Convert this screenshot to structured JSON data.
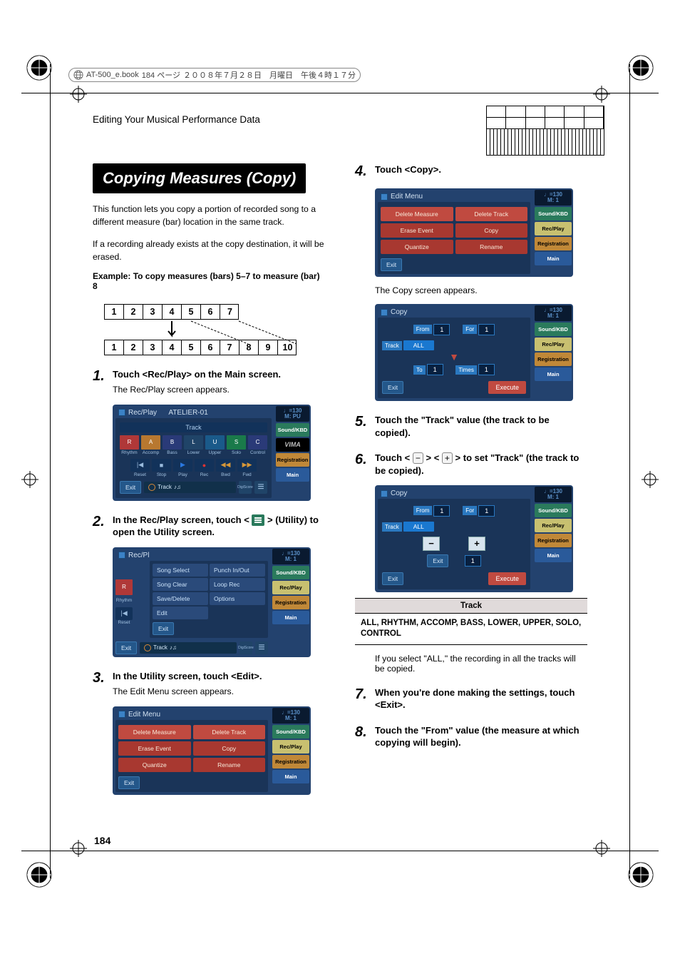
{
  "header": {
    "file": "AT-500_e.book",
    "page_info": "184 ページ",
    "date": "２００８年７月２８日　月曜日　午後４時１７分"
  },
  "section_heading": "Editing Your Musical Performance Data",
  "title": "Copying Measures (Copy)",
  "intro_p1": "This function lets you copy a portion of recorded song to a different measure (bar) location in the same track.",
  "intro_p2": "If a recording already exists at the copy destination, it will be erased.",
  "example_label": "Example: To copy measures (bars) 5–7 to measure (bar) 8",
  "diagram": {
    "row1": [
      "1",
      "2",
      "3",
      "4",
      "5",
      "6",
      "7"
    ],
    "row2": [
      "1",
      "2",
      "3",
      "4",
      "5",
      "6",
      "7",
      "8",
      "9",
      "10"
    ]
  },
  "steps": {
    "s1": {
      "num": "1.",
      "title": "Touch <Rec/Play> on the Main screen.",
      "sub": "The Rec/Play screen appears."
    },
    "s2": {
      "num": "2.",
      "title_pre": "In the Rec/Play screen, touch < ",
      "title_post": " > (Utility) to open the Utility screen."
    },
    "s3": {
      "num": "3.",
      "title": "In the Utility screen, touch <Edit>.",
      "sub": "The Edit Menu screen appears."
    },
    "s4": {
      "num": "4.",
      "title": "Touch <Copy>.",
      "sub": "The Copy screen appears."
    },
    "s5": {
      "num": "5.",
      "title": "Touch the \"Track\" value (the track to be copied)."
    },
    "s6": {
      "num": "6.",
      "title_pre": "Touch < ",
      "title_mid": " > < ",
      "title_post": " > to set \"Track\" (the track to be copied)."
    },
    "s7": {
      "num": "7.",
      "title": "When you're done making the settings, touch <Exit>."
    },
    "s8": {
      "num": "8.",
      "title": "Touch the \"From\" value (the measure at which copying will begin)."
    }
  },
  "track_table": {
    "header": "Track",
    "value": "ALL, RHYTHM, ACCOMP, BASS, LOWER, UPPER, SOLO, CONTROL"
  },
  "all_note": "If you select \"ALL,\" the recording in all the tracks will be copied.",
  "screenshots": {
    "common_side": {
      "tempo_label": "=130",
      "tempo_m": "M:",
      "sound": "Sound/KBD",
      "rec": "Rec/Play",
      "vima": "VIMA",
      "reg": "Registration",
      "main": "Main"
    },
    "recplay": {
      "title": "Rec/Play",
      "subtitle": "ATELIER-01",
      "track_label": "Track",
      "tiles": [
        "R",
        "A",
        "B",
        "L",
        "U",
        "S",
        "C"
      ],
      "tile_labels": [
        "Rhythm",
        "Accomp",
        "Bass",
        "Lower",
        "Upper",
        "Solo",
        "Control"
      ],
      "transport_labels": [
        "Reset",
        "Stop",
        "Play",
        "Rec",
        "Bwd",
        "Fwd"
      ],
      "exit": "Exit",
      "track_text": "Track",
      "digiscore": "DigiScore"
    },
    "utility": {
      "title": "Rec/Pl",
      "items": [
        "Song Select",
        "Punch In/Out",
        "Song Clear",
        "Loop Rec",
        "Save/Delete",
        "Options",
        "Edit"
      ],
      "exit": "Exit",
      "r_tile": "R",
      "r_label": "Rhythm",
      "reset": "Reset"
    },
    "editmenu": {
      "title": "Edit Menu",
      "items": [
        "Delete Measure",
        "Delete Track",
        "Erase Event",
        "Copy",
        "Quantize",
        "Rename"
      ],
      "exit": "Exit"
    },
    "copy": {
      "title": "Copy",
      "from": "From",
      "from_v": "1",
      "for": "For",
      "for_v": "1",
      "track": "Track",
      "track_v": "ALL",
      "to": "To",
      "to_v": "1",
      "times": "Times",
      "times_v": "1",
      "exit": "Exit",
      "execute": "Execute",
      "pu": "PU",
      "one": "1"
    }
  },
  "page_number": "184"
}
